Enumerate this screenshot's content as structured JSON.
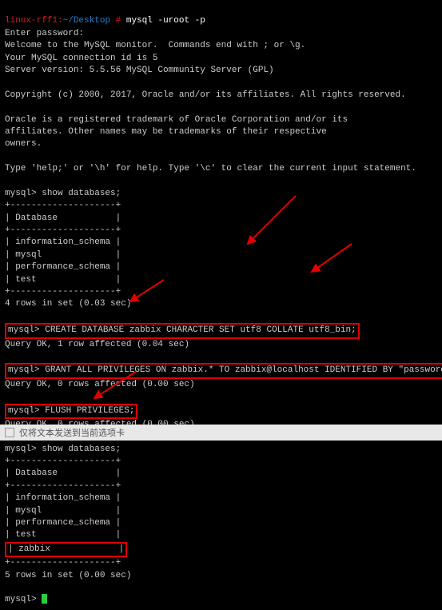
{
  "prompt": {
    "host": "linux-rff1",
    "path": "~/Desktop",
    "sep": " # "
  },
  "login_cmd": "mysql -uroot -p",
  "lines": {
    "enter_pw": "Enter password:",
    "welcome": "Welcome to the MySQL monitor.  Commands end with ; or \\g.",
    "conn_id": "Your MySQL connection id is 5",
    "server": "Server version: 5.5.56 MySQL Community Server (GPL)",
    "copyright": "Copyright (c) 2000, 2017, Oracle and/or its affiliates. All rights reserved.",
    "trademark1": "Oracle is a registered trademark of Oracle Corporation and/or its",
    "trademark2": "affiliates. Other names may be trademarks of their respective",
    "trademark3": "owners.",
    "help": "Type 'help;' or '\\h' for help. Type '\\c' to clear the current input statement."
  },
  "mysql_prompt": "mysql> ",
  "cmds": {
    "show1": "show databases;",
    "create": "CREATE DATABASE zabbix CHARACTER SET utf8 COLLATE utf8_bin;",
    "create_res": "Query OK, 1 row affected (0.04 sec)",
    "grant": "GRANT ALL PRIVILEGES ON zabbix.* TO zabbix@localhost IDENTIFIED BY \"password\";",
    "grant_res": "Query OK, 0 rows affected (0.00 sec)",
    "flush": "FLUSH PRIVILEGES;",
    "flush_res": "Query OK, 0 rows affected (0.00 sec)",
    "show2": "show databases;"
  },
  "table": {
    "border": "+--------------------+",
    "header": "| Database           |",
    "rows1": [
      "| information_schema |",
      "| mysql              |",
      "| performance_schema |",
      "| test               |"
    ],
    "res1": "4 rows in set (0.03 sec)",
    "rows2": [
      "| information_schema |",
      "| mysql              |",
      "| performance_schema |",
      "| test               |"
    ],
    "zabbix": "| zabbix             |",
    "res2": "5 rows in set (0.00 sec)"
  },
  "footer": "仅将文本发送到当前选项卡"
}
